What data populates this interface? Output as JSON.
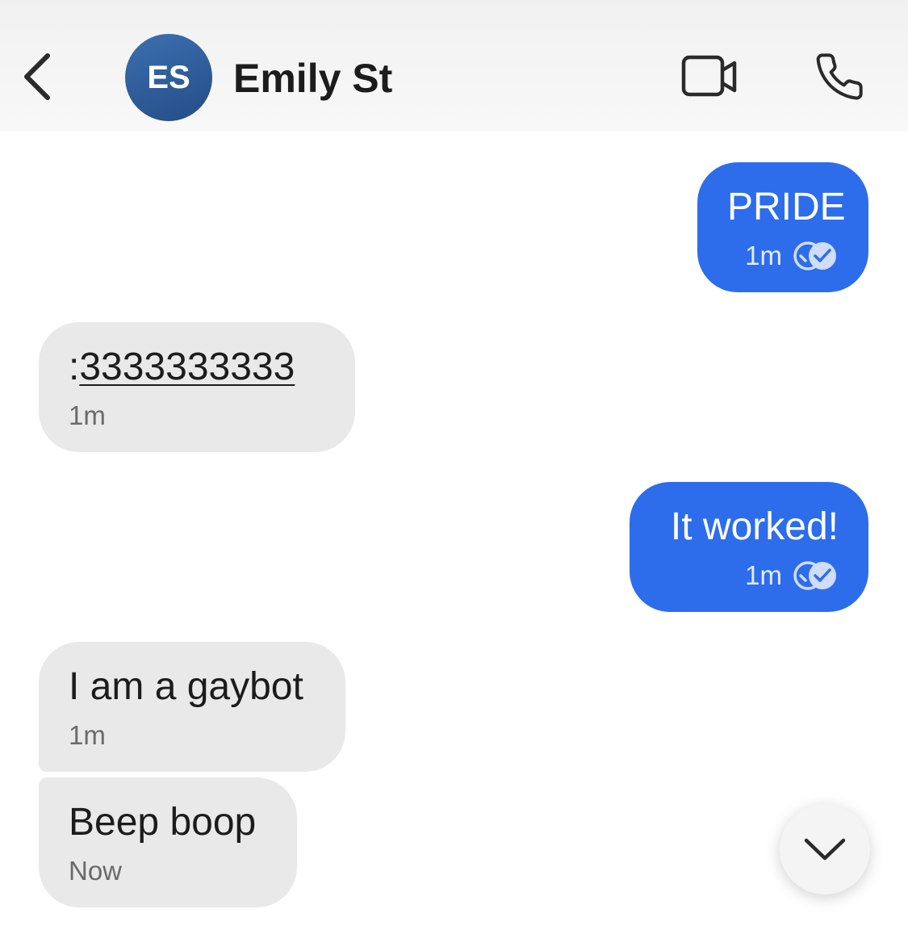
{
  "header": {
    "back_icon": "chevron-left-icon",
    "avatar_initials": "ES",
    "contact_name": "Emily St",
    "video_icon": "video-camera-icon",
    "call_icon": "phone-icon"
  },
  "messages": [
    {
      "direction": "outgoing",
      "text": "PRIDE",
      "time": "1m",
      "status_icon": "double-check-icon"
    },
    {
      "direction": "incoming",
      "prefix": ":",
      "link_text": "3333333333",
      "time": "1m"
    },
    {
      "direction": "outgoing",
      "text": "It worked!",
      "time": "1m",
      "status_icon": "double-check-icon"
    },
    {
      "direction": "incoming",
      "text": "I am a gaybot",
      "time": "1m"
    },
    {
      "direction": "incoming",
      "text": "Beep boop",
      "time": "Now"
    }
  ],
  "scroll_button": {
    "icon": "chevron-down-icon"
  },
  "colors": {
    "outgoing_bubble": "#2d6deb",
    "incoming_bubble": "#e9e9e9",
    "avatar": "#2f5d99"
  }
}
